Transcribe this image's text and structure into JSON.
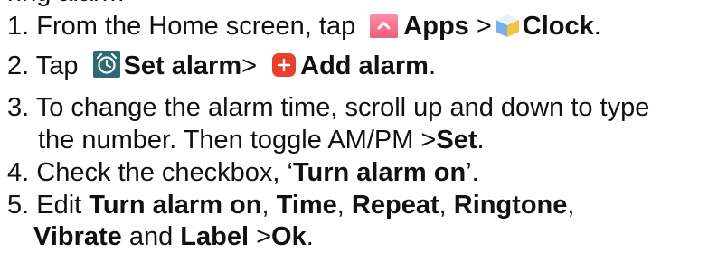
{
  "partial_top": "ring alarm",
  "steps": [
    {
      "num": "1. ",
      "t1": "From the Home screen, tap ",
      "b1": "Apps",
      "t2": " >",
      "b2": "Clock",
      "t3": "."
    },
    {
      "num": "2. ",
      "t1": "Tap ",
      "b1": "Set alarm",
      "t2": "> ",
      "b2": "Add alarm",
      "t3": "."
    },
    {
      "num": "3. ",
      "line1": "To change the alarm time, scroll up and down to type",
      "line2_text": "the number. Then toggle AM/PM >",
      "line2_bold": "Set",
      "line2_end": "."
    },
    {
      "num": "4. ",
      "t1": "Check the checkbox, ‘",
      "b1": "Turn alarm on",
      "t2": "’."
    },
    {
      "num": "5. ",
      "t1": "Edit ",
      "b1": "Turn alarm on",
      "s1": ", ",
      "b2": "Time",
      "s2": ", ",
      "b3": "Repeat",
      "s3": ", ",
      "b4": "Ringtone",
      "s4": ",",
      "l2b1": "Vibrate",
      "l2t1": " and ",
      "l2b2": "Label",
      "l2t2": " >",
      "l2b3": "Ok",
      "l2t3": "."
    }
  ],
  "icons": {
    "apps": "apps-icon",
    "clock": "clock-icon",
    "set_alarm": "alarm-clock-icon",
    "add_alarm": "add-alarm-icon"
  },
  "colors": {
    "apps_icon": "#f26b86",
    "clock_icon": "#6fa6e6",
    "alarm_icon_bg": "#2f6a73",
    "add_icon": "#e8402f"
  }
}
